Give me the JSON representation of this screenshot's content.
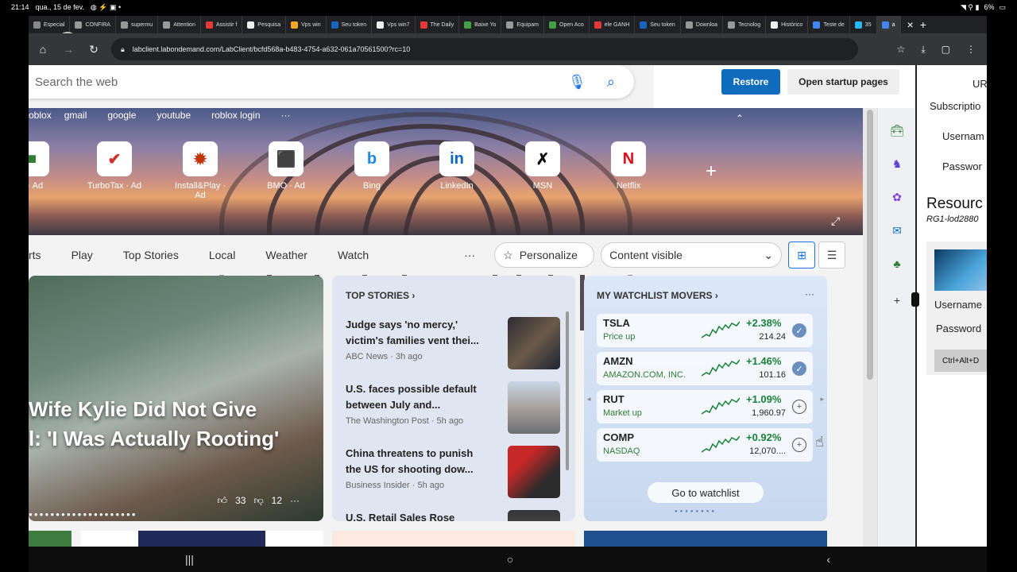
{
  "status_bar": {
    "time": "21:14",
    "date": "qua., 15 de fev.",
    "battery": "6%"
  },
  "tabs": [
    {
      "label": "Especial",
      "color": "#888"
    },
    {
      "label": "CONFIRA",
      "color": "#999"
    },
    {
      "label": "supermu",
      "color": "#999"
    },
    {
      "label": "Attention",
      "color": "#999"
    },
    {
      "label": "Assistir f",
      "color": "#e53935"
    },
    {
      "label": "Pesquisa",
      "color": "#eee"
    },
    {
      "label": "Vps win",
      "color": "#f5a623"
    },
    {
      "label": "Seu token",
      "color": "#1565c0"
    },
    {
      "label": "Vps win7",
      "color": "#eee"
    },
    {
      "label": "The Daily",
      "color": "#e53935"
    },
    {
      "label": "Baixe Yo",
      "color": "#43a047"
    },
    {
      "label": "Equipam",
      "color": "#999"
    },
    {
      "label": "Open Aco",
      "color": "#43a047"
    },
    {
      "label": "ele GANH",
      "color": "#e53935"
    },
    {
      "label": "Seu token",
      "color": "#1565c0"
    },
    {
      "label": "Downloa",
      "color": "#999"
    },
    {
      "label": "Tecnolog",
      "color": "#999"
    },
    {
      "label": "Histórico",
      "color": "#eee"
    },
    {
      "label": "Teste de",
      "color": "#4285f4"
    },
    {
      "label": "35",
      "color": "#29b6f6"
    },
    {
      "label": "a",
      "color": "#4285f4"
    }
  ],
  "url": "labclient.labondemand.com/LabClient/bcfd568a-b483-4754-a632-061a70561500?rc=10",
  "search": {
    "placeholder": "Search the web"
  },
  "restore": {
    "restore_label": "Restore",
    "open_startup_label": "Open startup pages"
  },
  "quick_links": [
    "oblox",
    "gmail",
    "google",
    "youtube",
    "roblox login",
    "···"
  ],
  "tiles": [
    {
      "label": "y · Ad",
      "glyph": "■",
      "color": "#2e7d32"
    },
    {
      "label": "TurboTax · Ad",
      "glyph": "✔",
      "color": "#d32f2f"
    },
    {
      "label": "Install&Play · Ad",
      "glyph": "✹",
      "color": "#bf360c"
    },
    {
      "label": "BMO · Ad",
      "glyph": "⬛",
      "color": "#d32f2f"
    },
    {
      "label": "Bing",
      "glyph": "b",
      "color": "#1e88e5"
    },
    {
      "label": "LinkedIn",
      "glyph": "in",
      "color": "#0a66c2"
    },
    {
      "label": "MSN",
      "glyph": "✗",
      "color": "#111"
    },
    {
      "label": "Netflix",
      "glyph": "N",
      "color": "#e50914"
    }
  ],
  "nav": {
    "items": [
      "rts",
      "Play",
      "Top Stories",
      "Local",
      "Weather",
      "Watch"
    ],
    "more": "···",
    "personalize": "Personalize",
    "content_visible": "Content visible"
  },
  "hero_card": {
    "headline": "Wife Kylie Did Not Give\nl: 'I Was Actually Rooting'",
    "likes": "33",
    "dislikes": "12"
  },
  "top_stories": {
    "title": "TOP STORIES",
    "items": [
      {
        "title": "Judge says 'no mercy,' victim's families vent thei...",
        "source": "ABC News · 3h ago"
      },
      {
        "title": "U.S. faces possible default between July and...",
        "source": "The Washington Post · 5h ago"
      },
      {
        "title": "China threatens to punish the US for shooting dow...",
        "source": "Business Insider · 5h ago"
      },
      {
        "title": "U.S. Retail Sales Rose",
        "source": ""
      }
    ]
  },
  "watchlist": {
    "title": "MY WATCHLIST MOVERS",
    "stocks": [
      {
        "symbol": "TSLA",
        "name": "Price up",
        "pct": "+2.38%",
        "price": "214.24",
        "following": true
      },
      {
        "symbol": "AMZN",
        "name": "AMAZON.COM, INC.",
        "pct": "+1.46%",
        "price": "101.16",
        "following": true
      },
      {
        "symbol": "RUT",
        "name": "Market up",
        "pct": "+1.09%",
        "price": "1,960.97",
        "following": false
      },
      {
        "symbol": "COMP",
        "name": "NASDAQ",
        "pct": "+0.92%",
        "price": "12,070....",
        "following": false
      }
    ],
    "go_label": "Go to watchlist"
  },
  "right_panel": {
    "url_label": "UR",
    "subscription": "Subscriptio",
    "username": "Usernam",
    "password": "Passwor",
    "resources": "Resourc",
    "rg": "RG1-lod2880",
    "username2": "Username",
    "password2": "Password",
    "ctrl_alt_del": "Ctrl+Alt+D"
  }
}
